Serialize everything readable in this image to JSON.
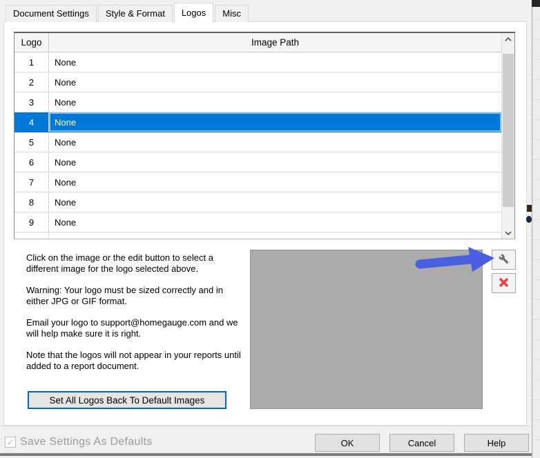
{
  "window": {
    "tabs": [
      {
        "label": "Document Settings"
      },
      {
        "label": "Style & Format"
      },
      {
        "label": "Logos"
      },
      {
        "label": "Misc"
      }
    ],
    "active_tab": "Logos"
  },
  "logo_table": {
    "logo_header": "Logo",
    "path_header": "Image Path",
    "rows": [
      {
        "logo": "1",
        "path": "None"
      },
      {
        "logo": "2",
        "path": "None"
      },
      {
        "logo": "3",
        "path": "None"
      },
      {
        "logo": "4",
        "path": "None"
      },
      {
        "logo": "5",
        "path": "None"
      },
      {
        "logo": "6",
        "path": "None"
      },
      {
        "logo": "7",
        "path": "None"
      },
      {
        "logo": "8",
        "path": "None"
      },
      {
        "logo": "9",
        "path": "None"
      }
    ],
    "selected_logo": "4"
  },
  "instructions": {
    "p1": "Click on the image or the edit button to select a different image for the logo selected above.",
    "p2": "Warning: Your logo must be sized correctly and in either JPG or GIF format.",
    "p3": "Email your logo to support@homegauge.com and we will help make sure it is right.",
    "p4": "Note that the logos will not appear in your reports until added to a report document."
  },
  "buttons": {
    "reset_all": "Set All Logos Back To Default Images",
    "ok": "OK",
    "cancel": "Cancel",
    "help": "Help"
  },
  "footer": {
    "save_defaults_label": "Save Settings As Defaults",
    "save_defaults_checked": true,
    "save_defaults_disabled": true,
    "check_glyph": "✓"
  },
  "icons": {
    "edit": "wrench-icon",
    "delete": "red-x-icon",
    "annotation": "blue-arrow-pointer"
  },
  "colors": {
    "selection_blue": "#0078d7",
    "arrow_blue": "#4a5fe0",
    "delete_red": "#dd4b4b",
    "preview_gray": "#ababab",
    "focus_border_blue": "#0067c0"
  }
}
